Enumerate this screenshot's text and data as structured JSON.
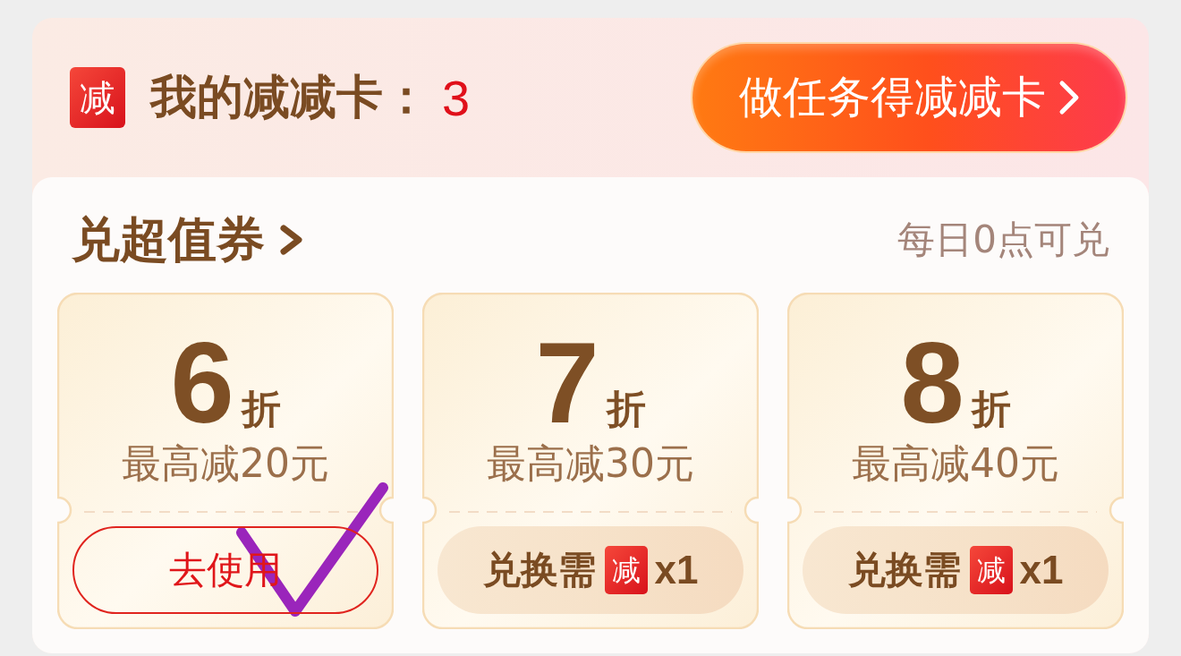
{
  "header": {
    "badge": "减",
    "title": "我的减减卡：",
    "count": "3",
    "task_button": "做任务得减减卡"
  },
  "exchange": {
    "title": "兑超值券",
    "note": "每日0点可兑",
    "coupons": [
      {
        "value": "6",
        "unit": "折",
        "limit": "最高减20元",
        "action": {
          "kind": "use",
          "label": "去使用"
        },
        "marked": true
      },
      {
        "value": "7",
        "unit": "折",
        "limit": "最高减30元",
        "action": {
          "kind": "redeem",
          "label": "兑换需",
          "badge": "减",
          "cost": "x1"
        },
        "marked": false
      },
      {
        "value": "8",
        "unit": "折",
        "limit": "最高减40元",
        "action": {
          "kind": "redeem",
          "label": "兑换需",
          "badge": "减",
          "cost": "x1"
        },
        "marked": false
      }
    ]
  }
}
